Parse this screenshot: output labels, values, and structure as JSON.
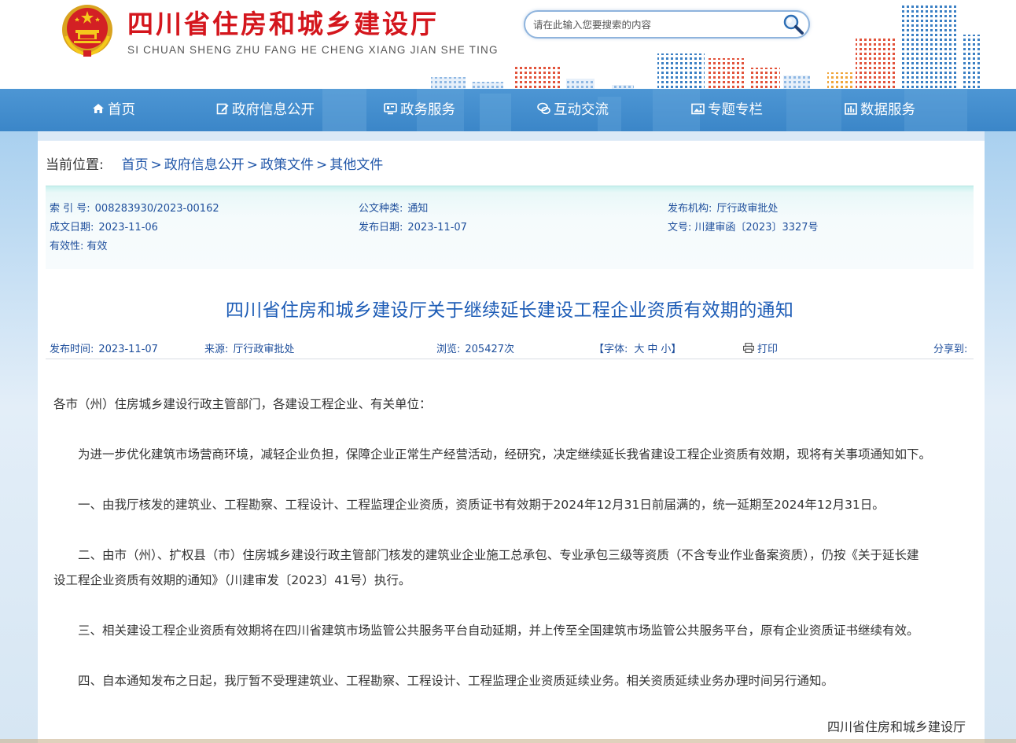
{
  "header": {
    "title": "四川省住房和城乡建设厅",
    "subtitle": "SI CHUAN SHENG ZHU FANG HE CHENG XIANG JIAN SHE TING",
    "search_placeholder": "请在此输入您要搜索的内容"
  },
  "nav": {
    "items": [
      {
        "label": "首页",
        "icon": "home-icon"
      },
      {
        "label": "政府信息公开",
        "icon": "edit-icon"
      },
      {
        "label": "政务服务",
        "icon": "monitor-icon"
      },
      {
        "label": "互动交流",
        "icon": "chat-icon"
      },
      {
        "label": "专题专栏",
        "icon": "image-icon"
      },
      {
        "label": "数据服务",
        "icon": "bar-chart-icon"
      }
    ]
  },
  "breadcrumb": {
    "prefix": "当前位置:",
    "items": [
      "首页",
      "政府信息公开",
      "政策文件",
      "其他文件"
    ],
    "separator": ">"
  },
  "meta": {
    "index_label": "索 引 号:",
    "index_value": "008283930/2023-00162",
    "type_label": "公文种类:",
    "type_value": "通知",
    "org_label": "发布机构:",
    "org_value": "厅行政审批处",
    "created_label": "成文日期:",
    "created_value": "2023-11-06",
    "published_label": "发布日期:",
    "published_value": "2023-11-07",
    "docno_label": "文号:",
    "docno_value": "川建审函〔2023〕3327号",
    "validity_label": "有效性:",
    "validity_value": "有效"
  },
  "article": {
    "title": "四川省住房和城乡建设厅关于继续延长建设工程企业资质有效期的通知",
    "publish_time_label": "发布时间:",
    "publish_time": "2023-11-07",
    "source_label": "来源:",
    "source": "厅行政审批处",
    "views_label": "浏览:",
    "views": "205427次",
    "font_open": "【字体:",
    "font_large": "大",
    "font_medium": "中",
    "font_small": "小】",
    "print_label": "打印",
    "share_label": "分享到:",
    "paragraphs": [
      "各市（州）住房城乡建设行政主管部门，各建设工程企业、有关单位：",
      "为进一步优化建筑市场营商环境，减轻企业负担，保障企业正常生产经营活动，经研究，决定继续延长我省建设工程企业资质有效期，现将有关事项通知如下。",
      "一、由我厅核发的建筑业、工程勘察、工程设计、工程监理企业资质，资质证书有效期于2024年12月31日前届满的，统一延期至2024年12月31日。",
      "二、由市（州）、扩权县（市）住房城乡建设行政主管部门核发的建筑业企业施工总承包、专业承包三级等资质（不含专业作业备案资质），仍按《关于延长建",
      "设工程企业资质有效期的通知》（川建审发〔2023〕41号）执行。",
      "三、相关建设工程企业资质有效期将在四川省建筑市场监管公共服务平台自动延期，并上传至全国建筑市场监管公共服务平台，原有企业资质证书继续有效。",
      "四、自本通知发布之日起，我厅暂不受理建筑业、工程勘察、工程设计、工程监理企业资质延续业务。相关资质延续业务办理时间另行通知。"
    ],
    "signature": "四川省住房和城乡建设厅"
  },
  "colors": {
    "title_red": "#d4161d",
    "nav_blue": "#3b86c8",
    "link_blue": "#1f55a8",
    "meta_blue": "#1f4f9c"
  }
}
